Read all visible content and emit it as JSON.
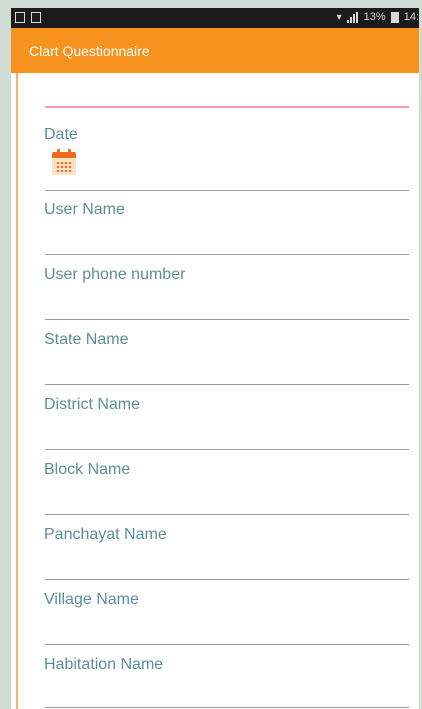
{
  "status_bar": {
    "battery_text": "13%",
    "time": "14:",
    "icons": [
      "photo-icon",
      "notification-icon",
      "wifi-icon",
      "signal-icon",
      "battery-icon"
    ]
  },
  "app_bar": {
    "title": "Clart Questionnaire",
    "color": "#f7921e"
  },
  "form": {
    "date_label": "Date",
    "date_icon": "calendar-icon",
    "fields": [
      {
        "label": "User Name"
      },
      {
        "label": "User phone number"
      },
      {
        "label": "State Name"
      },
      {
        "label": "District Name"
      },
      {
        "label": "Block Name"
      },
      {
        "label": "Panchayat Name"
      },
      {
        "label": "Village Name"
      },
      {
        "label": "Habitation Name"
      }
    ]
  },
  "colors": {
    "label": "#5c8e96",
    "focus_line": "#f19bb8",
    "accent": "#f7921e"
  }
}
